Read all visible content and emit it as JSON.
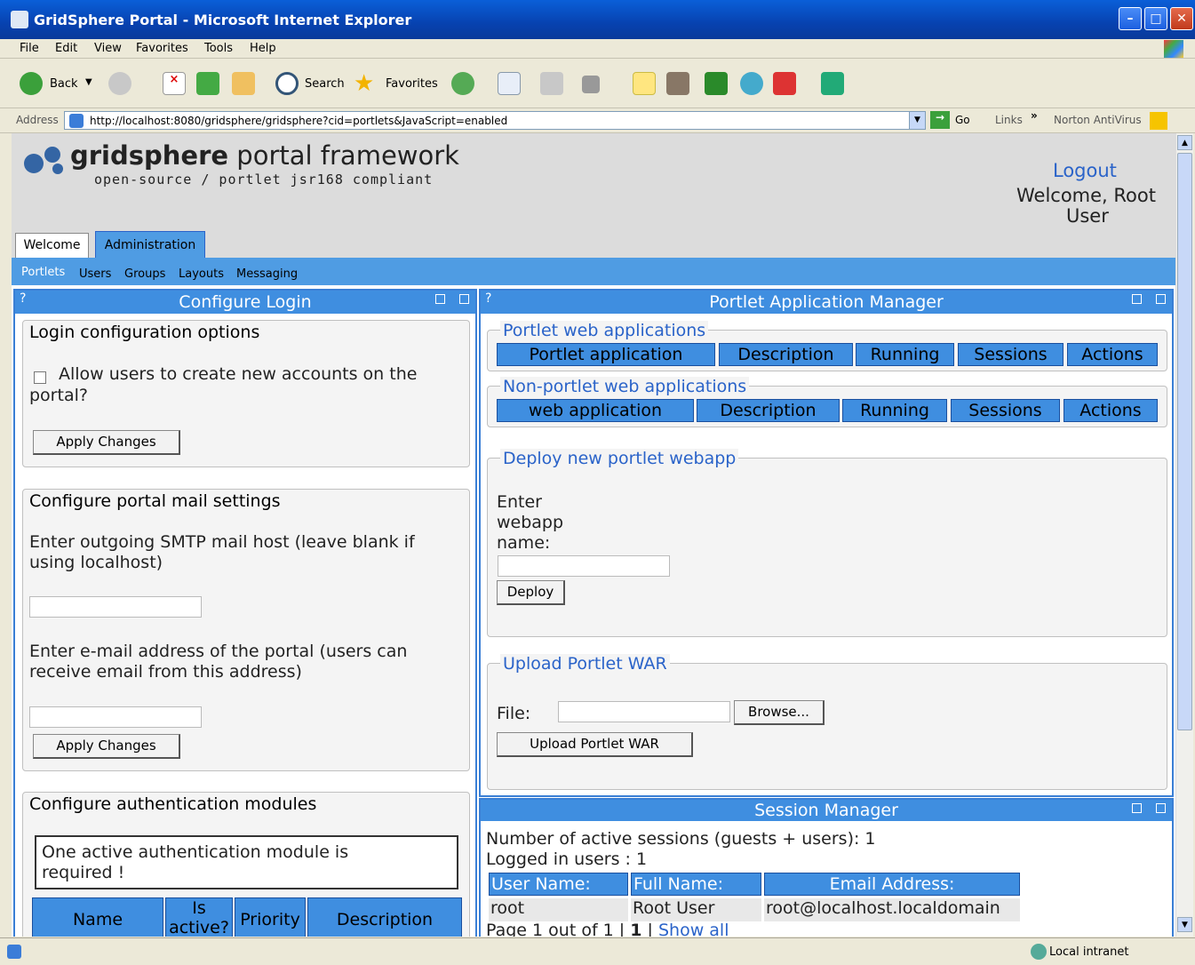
{
  "window": {
    "title": "GridSphere Portal - Microsoft Internet Explorer"
  },
  "menu": [
    "File",
    "Edit",
    "View",
    "Favorites",
    "Tools",
    "Help"
  ],
  "toolbar": {
    "back_label": "Back",
    "search_label": "Search",
    "favorites_label": "Favorites"
  },
  "addressbar": {
    "label": "Address",
    "url": "http://localhost:8080/gridsphere/gridsphere?cid=portlets&JavaScript=enabled",
    "go_label": "Go",
    "links_label": "Links",
    "chevron": "»",
    "norton_label": "Norton AntiVirus"
  },
  "header": {
    "brand_bold": "gridsphere",
    "brand_rest": "portal framework",
    "tagline": "open-source / portlet jsr168 compliant",
    "logout": "Logout",
    "welcome": "Welcome, Root",
    "welcome_user": "User"
  },
  "tabs": [
    "Welcome",
    "Administration"
  ],
  "subnav": [
    "Portlets",
    "Users",
    "Groups",
    "Layouts",
    "Messaging"
  ],
  "login_panel": {
    "help": "?",
    "title": "Configure Login",
    "options_heading": "Login configuration options",
    "allow_line1": "Allow users to create new accounts on the",
    "allow_line2": "portal?",
    "apply1": "Apply Changes",
    "mail_heading": "Configure portal mail settings",
    "smtp_line1": "Enter outgoing SMTP mail host (leave blank if",
    "smtp_line2": "using localhost)",
    "email_line1": "Enter e-mail address of the portal (users can",
    "email_line2": "receive email from this address)",
    "apply2": "Apply Changes",
    "auth_heading": "Configure authentication modules",
    "auth_note_line1": "One active authentication module is",
    "auth_note_line2": "required !",
    "auth_cols": [
      "Name",
      "Is",
      "active?",
      "Priority",
      "Description"
    ]
  },
  "pam_panel": {
    "help": "?",
    "title": "Portlet Application Manager",
    "pwa_legend": "Portlet web applications",
    "pwa_cols": [
      "Portlet application",
      "Description",
      "Running",
      "Sessions",
      "Actions"
    ],
    "npwa_legend": "Non-portlet web applications",
    "npwa_cols": [
      "web application",
      "Description",
      "Running",
      "Sessions",
      "Actions"
    ],
    "deploy_legend": "Deploy new portlet webapp",
    "enter_l1": "Enter",
    "enter_l2": "webapp",
    "enter_l3": "name:",
    "deploy_btn": "Deploy",
    "upload_legend": "Upload Portlet WAR",
    "file_label": "File:",
    "browse_btn": "Browse...",
    "upload_btn": "Upload Portlet WAR"
  },
  "session_panel": {
    "title": "Session Manager",
    "active_line": "Number of active sessions (guests + users): 1",
    "logged_line": "Logged in users : 1",
    "cols": [
      "User Name:",
      "Full Name:",
      "Email Address:"
    ],
    "rows": [
      [
        "root",
        "Root User",
        "root@localhost.localdomain"
      ]
    ],
    "page_text": "Page 1 out of 1 |",
    "page_num": "1",
    "page_sep": "|",
    "show_all": "Show all"
  },
  "status": {
    "zone": "Local intranet"
  }
}
